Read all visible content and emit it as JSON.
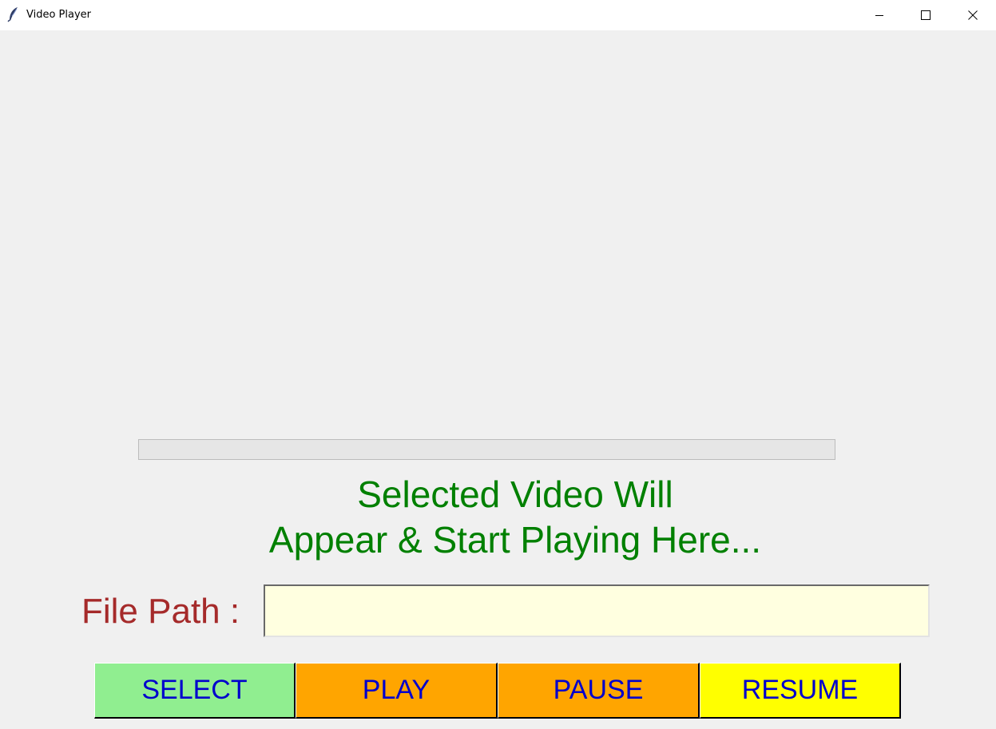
{
  "window": {
    "title": "Video Player",
    "icon": "feather-icon",
    "controls": [
      "minimize-icon",
      "maximize-icon",
      "close-icon"
    ]
  },
  "progress": {
    "value": 0
  },
  "video_area": {
    "message_line1": "Selected Video Will",
    "message_line2": "Appear & Start Playing Here..."
  },
  "file_path": {
    "label": "File Path :",
    "value": ""
  },
  "buttons": {
    "select": "SELECT",
    "play": "PLAY",
    "pause": "PAUSE",
    "resume": "RESUME"
  },
  "colors": {
    "message_text": "#008000",
    "label_text": "#a52a2a",
    "button_text": "#0000cd",
    "input_background": "#ffffe0",
    "select_button": "#90ee90",
    "play_button": "#ffa500",
    "pause_button": "#ffa500",
    "resume_button": "#ffff00",
    "window_background": "#f0f0f0"
  }
}
